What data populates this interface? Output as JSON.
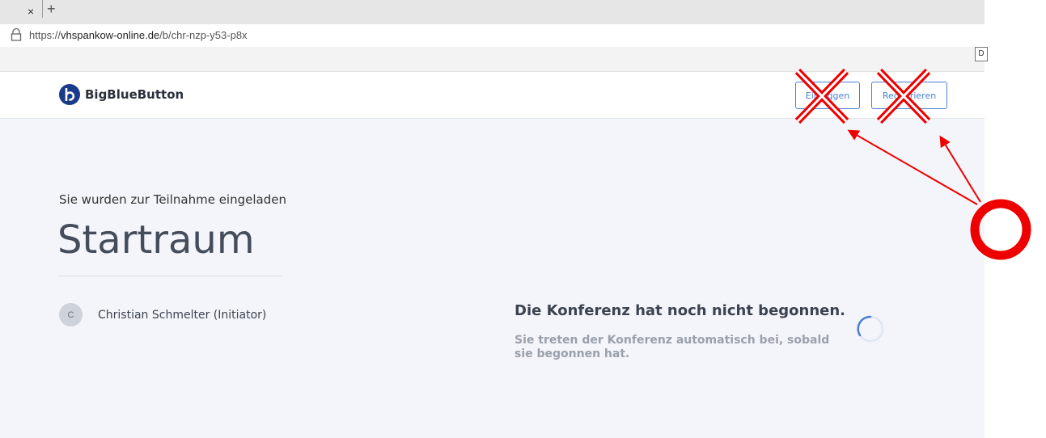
{
  "browser": {
    "tab_close": "×",
    "tab_new": "+",
    "url_scheme": "https://",
    "url_host": "vhspankow-online.de",
    "url_path": "/b/chr-nzp-y53-p8x",
    "ext_button": "D"
  },
  "header": {
    "brand": "BigBlueButton",
    "login_label": "Einloggen",
    "register_label": "Registrieren"
  },
  "main": {
    "invite_text": "Sie wurden zur Teilnahme eingeladen",
    "room_name": "Startraum",
    "owner_initial": "C",
    "owner_name": "Christian Schmelter (Initiator)",
    "status_title": "Die Konferenz hat noch nicht begonnen.",
    "status_subtitle": "Sie treten der Konferenz automatisch bei, sobald sie begonnen hat."
  },
  "colors": {
    "accent": "#4a7fd4",
    "annotation": "#ee0000",
    "background": "#f4f5fa"
  }
}
